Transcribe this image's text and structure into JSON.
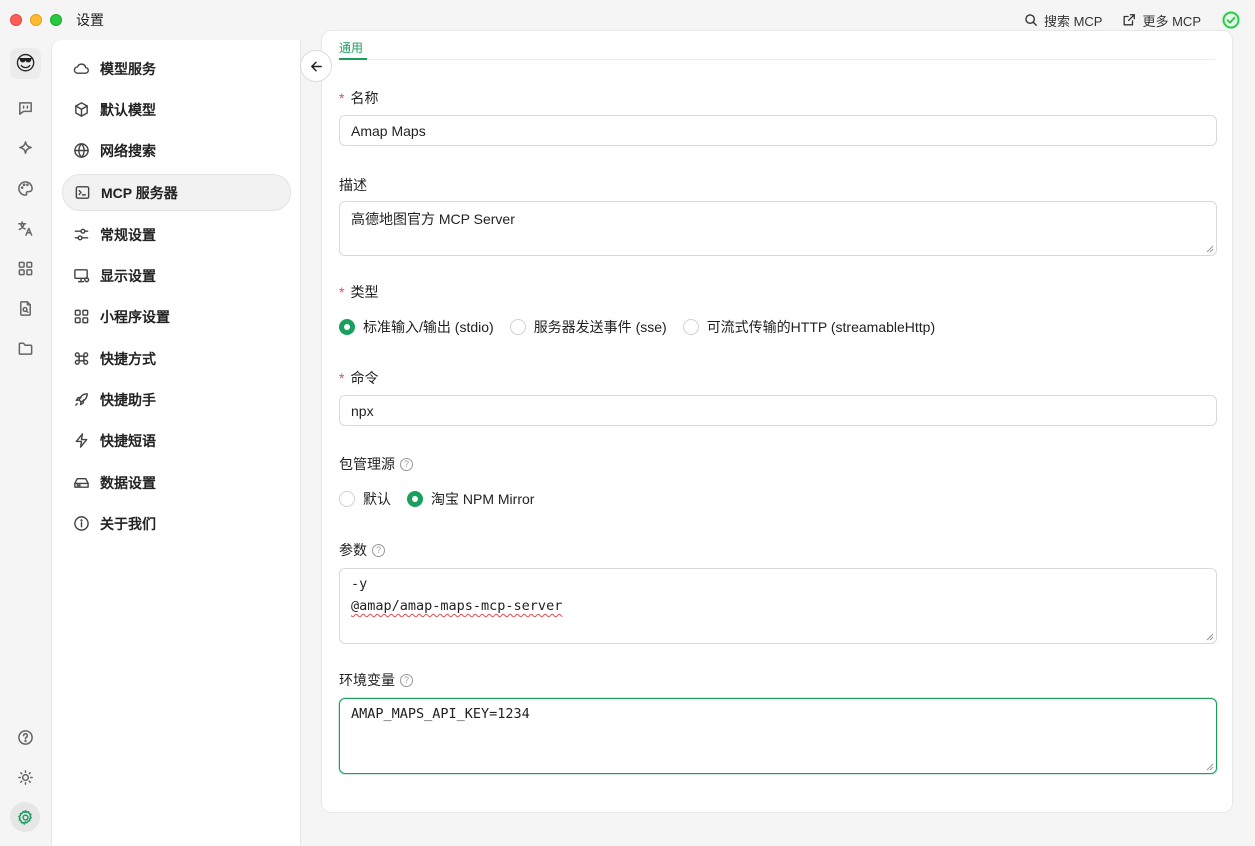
{
  "window": {
    "title": "设置"
  },
  "toolbar": {
    "search_mcp_label": "搜索 MCP",
    "more_mcp_label": "更多 MCP"
  },
  "rail": {
    "avatar_emoji": "😎",
    "icons": [
      "chat-icon",
      "sparkle-icon",
      "palette-icon",
      "translate-icon",
      "apps-grid-icon",
      "file-search-icon",
      "folder-icon",
      "help-icon",
      "theme-sun-icon",
      "settings-gear-icon"
    ]
  },
  "menu": {
    "items": [
      {
        "label": "模型服务",
        "icon": "cloud-icon"
      },
      {
        "label": "默认模型",
        "icon": "cube-icon"
      },
      {
        "label": "网络搜索",
        "icon": "globe-icon"
      },
      {
        "label": "MCP 服务器",
        "icon": "terminal-icon",
        "active": true
      },
      {
        "label": "常规设置",
        "icon": "sliders-icon"
      },
      {
        "label": "显示设置",
        "icon": "monitor-icon"
      },
      {
        "label": "小程序设置",
        "icon": "grid-icon"
      },
      {
        "label": "快捷方式",
        "icon": "command-icon"
      },
      {
        "label": "快捷助手",
        "icon": "rocket-icon"
      },
      {
        "label": "快捷短语",
        "icon": "zap-icon"
      },
      {
        "label": "数据设置",
        "icon": "drive-icon"
      },
      {
        "label": "关于我们",
        "icon": "info-icon"
      }
    ]
  },
  "form": {
    "tab_label": "通用",
    "name": {
      "label": "名称",
      "value": "Amap Maps"
    },
    "description": {
      "label": "描述",
      "value": "高德地图官方 MCP Server"
    },
    "type": {
      "label": "类型",
      "options": [
        "标准输入/输出 (stdio)",
        "服务器发送事件 (sse)",
        "可流式传输的HTTP (streamableHttp)"
      ],
      "selected_index": 0
    },
    "command": {
      "label": "命令",
      "value": "npx"
    },
    "package_registry": {
      "label": "包管理源",
      "options": [
        "默认",
        "淘宝 NPM Mirror"
      ],
      "selected_index": 1
    },
    "args": {
      "label": "参数",
      "line1": "-y",
      "line2": "@amap/amap-maps-mcp-server"
    },
    "env": {
      "label": "环境变量",
      "value": "AMAP_MAPS_API_KEY=1234"
    }
  },
  "colors": {
    "accent": "#1a9f5f",
    "required": "#e5484d"
  }
}
